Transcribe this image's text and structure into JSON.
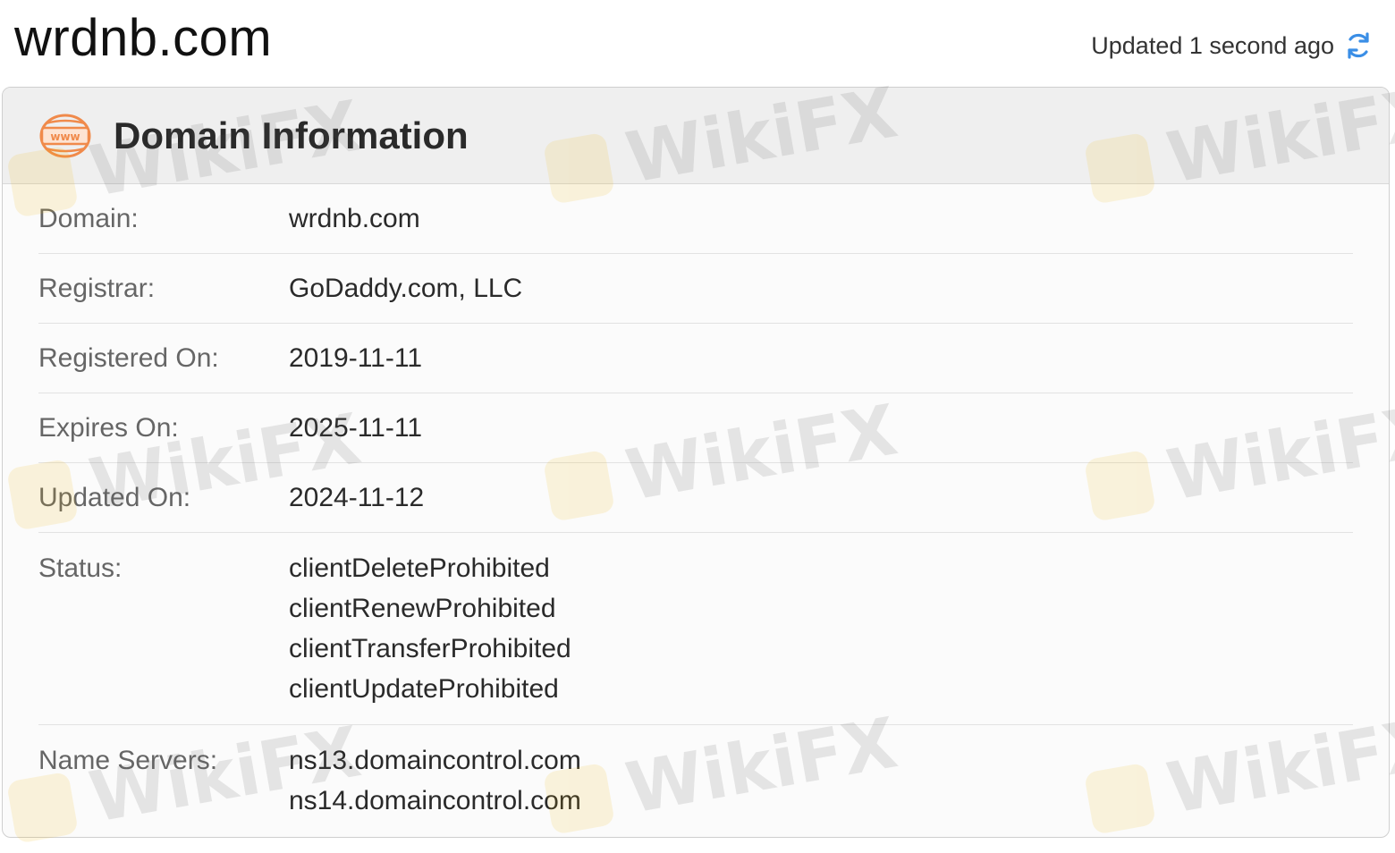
{
  "header": {
    "site_title": "wrdnb.com",
    "updated_text": "Updated 1 second ago",
    "refresh_icon": "refresh-icon"
  },
  "card": {
    "title": "Domain Information",
    "icon": "www-globe-icon",
    "rows": [
      {
        "label": "Domain:",
        "values": [
          "wrdnb.com"
        ]
      },
      {
        "label": "Registrar:",
        "values": [
          "GoDaddy.com, LLC"
        ]
      },
      {
        "label": "Registered On:",
        "values": [
          "2019-11-11"
        ]
      },
      {
        "label": "Expires On:",
        "values": [
          "2025-11-11"
        ]
      },
      {
        "label": "Updated On:",
        "values": [
          "2024-11-12"
        ]
      },
      {
        "label": "Status:",
        "values": [
          "clientDeleteProhibited",
          "clientRenewProhibited",
          "clientTransferProhibited",
          "clientUpdateProhibited"
        ]
      },
      {
        "label": "Name Servers:",
        "values": [
          "ns13.domaincontrol.com",
          "ns14.domaincontrol.com"
        ]
      }
    ]
  },
  "watermark": {
    "text": "WikiFX"
  },
  "colors": {
    "accent": "#3a8ee6",
    "icon_orange": "#f08a4b",
    "watermark_gold": "#f2b705"
  }
}
